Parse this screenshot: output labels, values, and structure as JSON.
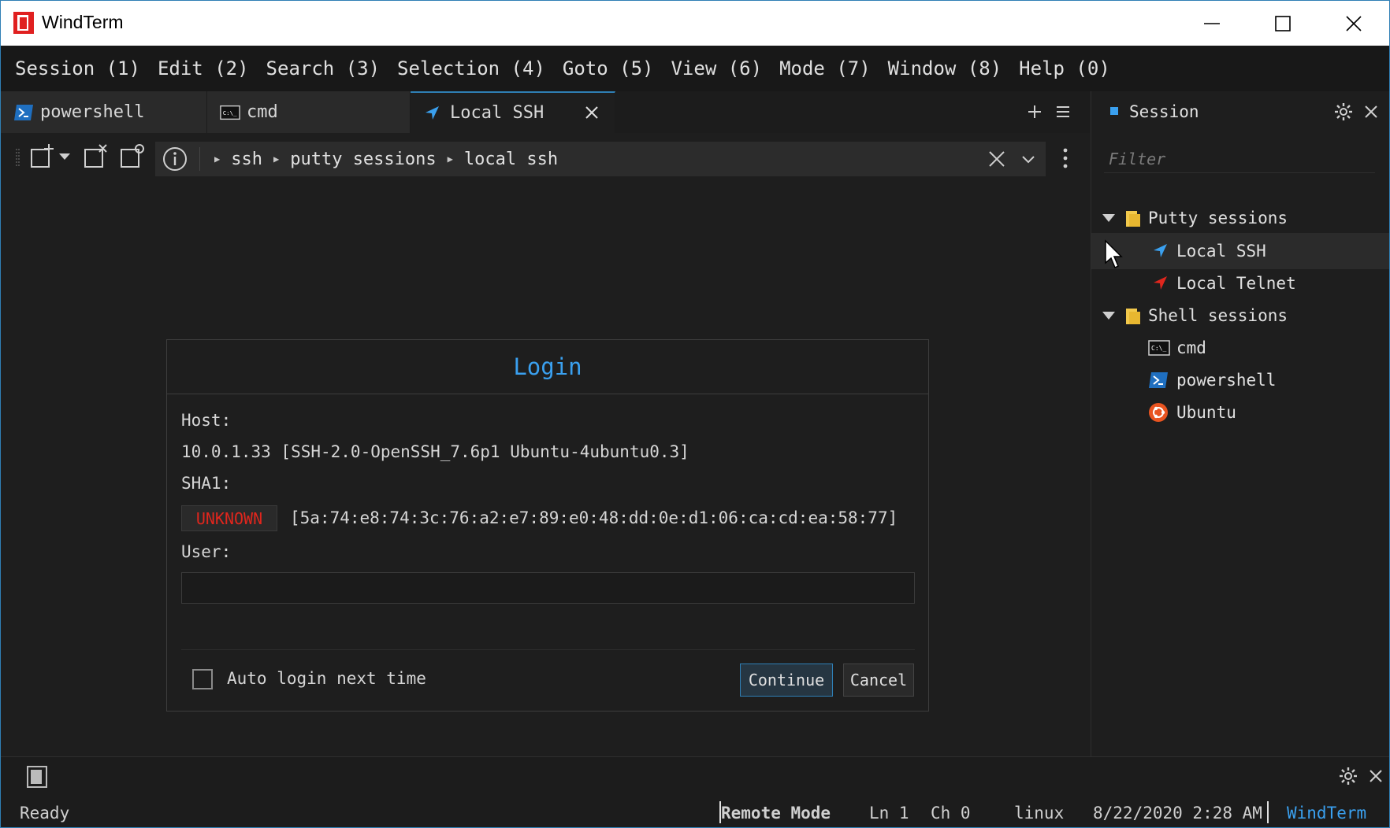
{
  "window": {
    "title": "WindTerm"
  },
  "menu": [
    "Session (1)",
    "Edit (2)",
    "Search (3)",
    "Selection (4)",
    "Goto (5)",
    "View (6)",
    "Mode (7)",
    "Window (8)",
    "Help (0)"
  ],
  "tabs": [
    {
      "label": "powershell",
      "icon": "powershell-icon"
    },
    {
      "label": "cmd",
      "icon": "cmd-icon"
    },
    {
      "label": "Local SSH",
      "icon": "ssh-arrow-icon",
      "active": true
    }
  ],
  "breadcrumb": [
    "ssh",
    "putty sessions",
    "local ssh"
  ],
  "login": {
    "title": "Login",
    "host_label": "Host:",
    "host_value": "10.0.1.33 [SSH-2.0-OpenSSH_7.6p1 Ubuntu-4ubuntu0.3]",
    "sha_label": "SHA1:",
    "sha_status": "UNKNOWN",
    "sha_value": "[5a:74:e8:74:3c:76:a2:e7:89:e0:48:dd:0e:d1:06:ca:cd:ea:58:77]",
    "user_label": "User:",
    "user_value": "",
    "auto_login_label": "Auto login next time",
    "auto_login_checked": false,
    "continue_label": "Continue",
    "cancel_label": "Cancel"
  },
  "session_panel": {
    "title": "Session",
    "filter_placeholder": "Filter",
    "groups": [
      {
        "label": "Putty sessions",
        "items": [
          "Local SSH",
          "Local Telnet"
        ]
      },
      {
        "label": "Shell sessions",
        "items": [
          "cmd",
          "powershell",
          "Ubuntu"
        ]
      }
    ]
  },
  "status": {
    "ready": "Ready",
    "mode": "Remote Mode",
    "line": "Ln 1",
    "col": "Ch 0",
    "os": "linux",
    "datetime": "8/22/2020 2:28 AM",
    "brand": "WindTerm"
  },
  "colors": {
    "accent": "#3aa0ef",
    "warning": "#e0261d",
    "brand_red": "#e02020"
  }
}
